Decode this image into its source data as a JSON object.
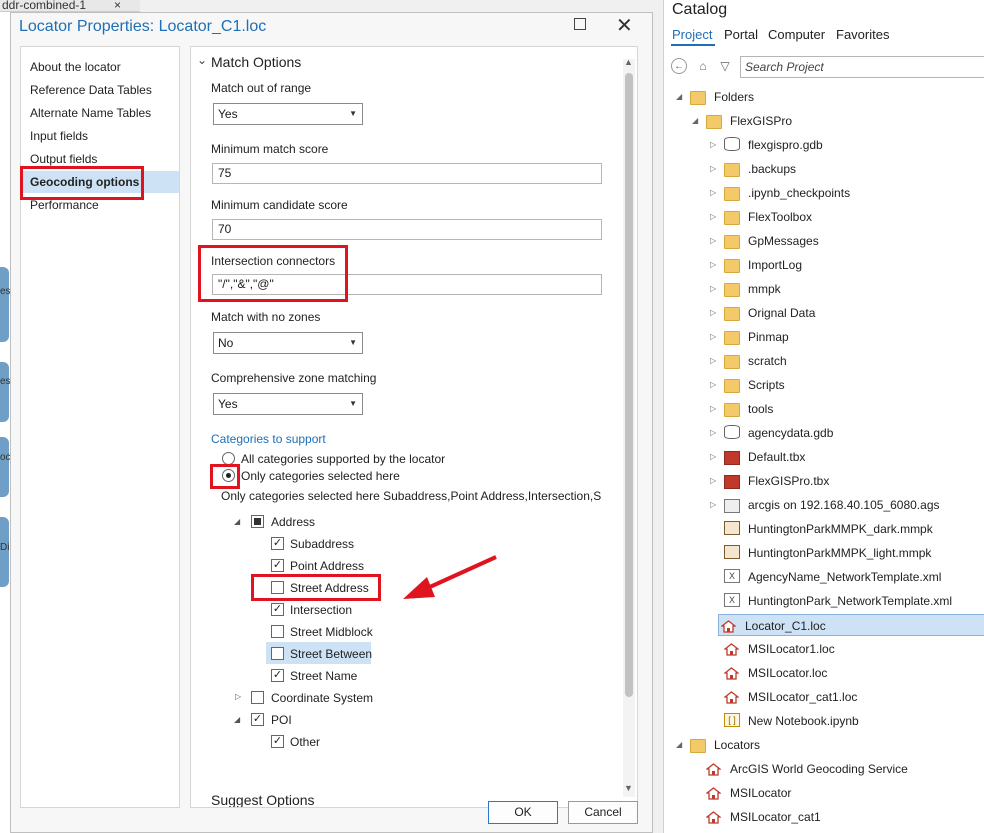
{
  "background": {
    "tab_label": "ddr-combined-1",
    "tab_close": "×",
    "fragments": [
      "es",
      "es",
      "oc",
      "Di"
    ]
  },
  "dialog": {
    "title": "Locator Properties: Locator_C1.loc",
    "maximize_icon": "maximize-icon",
    "close_glyph": "✕",
    "nav": [
      "About the locator",
      "Reference Data Tables",
      "Alternate Name Tables",
      "Input fields",
      "Output fields",
      "Geocoding options",
      "Performance"
    ],
    "selected_nav": "Geocoding options",
    "section_title": "Match Options",
    "section_chevron": "⌄",
    "match_out_of_range": {
      "label": "Match out of range",
      "value": "Yes"
    },
    "min_match_score": {
      "label": "Minimum match score",
      "value": "75"
    },
    "min_candidate_score": {
      "label": "Minimum candidate score",
      "value": "70"
    },
    "intersection_connectors": {
      "label": "Intersection connectors",
      "value": "\"/\",\"&\",\"@\""
    },
    "match_no_zones": {
      "label": "Match with no zones",
      "value": "No"
    },
    "comprehensive_zone": {
      "label": "Comprehensive zone matching",
      "value": "Yes"
    },
    "categories": {
      "heading": "Categories to support",
      "option_all": "All categories supported by the locator",
      "option_selected": "Only categories selected here",
      "summary": "Only categories selected here Subaddress,Point Address,Intersection,Stre",
      "tree": {
        "address": "Address",
        "subaddress": "Subaddress",
        "point_address": "Point Address",
        "street_address": "Street Address",
        "intersection": "Intersection",
        "street_midblock": "Street Midblock",
        "street_between": "Street Between",
        "street_name": "Street Name",
        "coordinate_system": "Coordinate System",
        "poi": "POI",
        "other": "Other"
      },
      "checked": [
        "subaddress",
        "point_address",
        "intersection",
        "street_name",
        "poi",
        "other"
      ]
    },
    "next_section": "Suggest Options",
    "ok_label": "OK",
    "cancel_label": "Cancel"
  },
  "catalog": {
    "title": "Catalog",
    "tabs": [
      "Project",
      "Portal",
      "Computer",
      "Favorites"
    ],
    "active_tab": "Project",
    "search_placeholder": "Search Project",
    "tree": [
      {
        "label": "Folders",
        "level": 0,
        "icon": "folder-icon",
        "twisty": "◢"
      },
      {
        "label": "FlexGISPro",
        "level": 1,
        "icon": "home-folder-icon",
        "twisty": "◢"
      },
      {
        "label": "flexgispro.gdb",
        "level": 2,
        "icon": "geodatabase-icon",
        "twisty": "▷"
      },
      {
        "label": ".backups",
        "level": 2,
        "icon": "folder-icon",
        "twisty": "▷"
      },
      {
        "label": ".ipynb_checkpoints",
        "level": 2,
        "icon": "folder-icon",
        "twisty": "▷"
      },
      {
        "label": "FlexToolbox",
        "level": 2,
        "icon": "folder-icon",
        "twisty": "▷"
      },
      {
        "label": "GpMessages",
        "level": 2,
        "icon": "folder-icon",
        "twisty": "▷"
      },
      {
        "label": "ImportLog",
        "level": 2,
        "icon": "folder-icon",
        "twisty": "▷"
      },
      {
        "label": "mmpk",
        "level": 2,
        "icon": "folder-icon",
        "twisty": "▷"
      },
      {
        "label": "Orignal Data",
        "level": 2,
        "icon": "folder-icon",
        "twisty": "▷"
      },
      {
        "label": "Pinmap",
        "level": 2,
        "icon": "folder-icon",
        "twisty": "▷"
      },
      {
        "label": "scratch",
        "level": 2,
        "icon": "folder-icon",
        "twisty": "▷"
      },
      {
        "label": "Scripts",
        "level": 2,
        "icon": "folder-icon",
        "twisty": "▷"
      },
      {
        "label": "tools",
        "level": 2,
        "icon": "folder-icon",
        "twisty": "▷"
      },
      {
        "label": "agencydata.gdb",
        "level": 2,
        "icon": "geodatabase-icon",
        "twisty": "▷"
      },
      {
        "label": "Default.tbx",
        "level": 2,
        "icon": "toolbox-icon",
        "twisty": "▷"
      },
      {
        "label": "FlexGISPro.tbx",
        "level": 2,
        "icon": "toolbox-icon",
        "twisty": "▷"
      },
      {
        "label": "arcgis on 192.168.40.105_6080.ags",
        "level": 2,
        "icon": "server-icon",
        "twisty": "▷"
      },
      {
        "label": "HuntingtonParkMMPK_dark.mmpk",
        "level": 2,
        "icon": "map-package-icon",
        "twisty": ""
      },
      {
        "label": "HuntingtonParkMMPK_light.mmpk",
        "level": 2,
        "icon": "map-package-icon",
        "twisty": ""
      },
      {
        "label": "AgencyName_NetworkTemplate.xml",
        "level": 2,
        "icon": "xml-icon",
        "twisty": ""
      },
      {
        "label": "HuntingtonPark_NetworkTemplate.xml",
        "level": 2,
        "icon": "xml-icon",
        "twisty": ""
      },
      {
        "label": "Locator_C1.loc",
        "level": 2,
        "icon": "locator-icon",
        "twisty": "",
        "selected": true
      },
      {
        "label": "MSILocator1.loc",
        "level": 2,
        "icon": "locator-icon",
        "twisty": ""
      },
      {
        "label": "MSILocator.loc",
        "level": 2,
        "icon": "locator-icon",
        "twisty": ""
      },
      {
        "label": "MSILocator_cat1.loc",
        "level": 2,
        "icon": "locator-icon",
        "twisty": ""
      },
      {
        "label": "New Notebook.ipynb",
        "level": 2,
        "icon": "notebook-icon",
        "twisty": ""
      },
      {
        "label": "Locators",
        "level": 0,
        "icon": "locators-folder-icon",
        "twisty": "◢"
      },
      {
        "label": "ArcGIS World Geocoding Service",
        "level": 1,
        "icon": "world-locator-icon",
        "twisty": ""
      },
      {
        "label": "MSILocator",
        "level": 1,
        "icon": "locator-icon",
        "twisty": ""
      },
      {
        "label": "MSILocator_cat1",
        "level": 1,
        "icon": "locator-icon",
        "twisty": ""
      }
    ]
  },
  "colors": {
    "accent": "#1e6fb6",
    "selection": "#cde3f5",
    "annotation_red": "#e0141e"
  }
}
